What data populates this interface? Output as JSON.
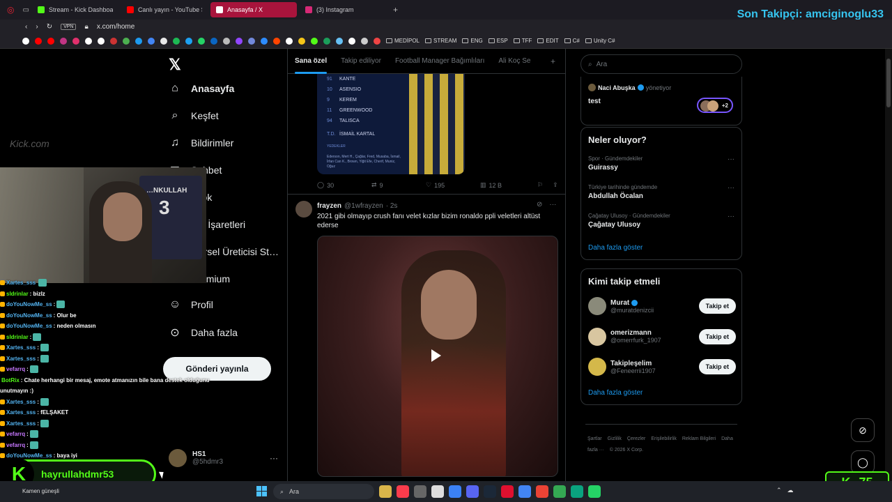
{
  "browser": {
    "tabs": [
      {
        "label": "Stream - Kick Dashboard",
        "color": "#53fc18",
        "active": false
      },
      {
        "label": "Canlı yayın - YouTube Stud",
        "color": "#ff0000",
        "active": false
      },
      {
        "label": "Anasayfa / X",
        "color": "#ffffff",
        "active": true
      },
      {
        "label": "(3) Instagram",
        "color": "#d62976",
        "active": false
      }
    ],
    "url": "x.com/home",
    "vpn_label": "VPN",
    "bookmark_folders": [
      "MEDİPOL",
      "STREAM",
      "ENG",
      "ESP",
      "TFF",
      "EDIT",
      "C#",
      "Unity C#"
    ],
    "follower_overlay": "Son Takipçi: amciginoglu33"
  },
  "x": {
    "nav": [
      {
        "label": "Anasayfa",
        "icon": "home-icon",
        "active": true
      },
      {
        "label": "Keşfet",
        "icon": "search-icon",
        "active": false
      },
      {
        "label": "Bildirimler",
        "icon": "bell-icon",
        "active": false
      },
      {
        "label": "Sohbet",
        "icon": "chat-icon",
        "active": false
      },
      {
        "label": "Grok",
        "icon": "grok-icon",
        "active": false
      },
      {
        "label": "Yer İşaretleri",
        "icon": "bookmark-icon",
        "active": false
      },
      {
        "label": "Görsel Üreticisi St…",
        "icon": "image-icon",
        "active": false
      },
      {
        "label": "Premium",
        "icon": "premium-icon",
        "active": false
      },
      {
        "label": "Profil",
        "icon": "person-icon",
        "active": false
      },
      {
        "label": "Daha fazla",
        "icon": "more-circle-icon",
        "active": false
      }
    ],
    "post_button": "Gönderi yayınla",
    "account": {
      "name": "HS1",
      "handle": "@5hdmr3"
    },
    "timeline_tabs": [
      "Sana özel",
      "Takip ediliyor",
      "Football Manager Bağımlıları",
      "Ali Koç Se"
    ],
    "tweet1": {
      "lineup": [
        {
          "num": "91",
          "name": "KANTE"
        },
        {
          "num": "10",
          "name": "ASENSIO"
        },
        {
          "num": "9",
          "name": "KEREM"
        },
        {
          "num": "11",
          "name": "GREENWOOD"
        },
        {
          "num": "94",
          "name": "TALISCA"
        }
      ],
      "coach": {
        "num": "T.D.",
        "name": "İSMAİL KARTAL"
      },
      "subs_label": "YEDEKLER",
      "subs_text": "Ederson, Mert H., Çağlar, Fred, Musaba, İsmail, İrfan Can K., Brown, Yiğit Efe, Cherif, Muniz, Oğuz",
      "stats": {
        "replies": "30",
        "retweets": "9",
        "likes": "195",
        "views": "12 B"
      }
    },
    "tweet2": {
      "name": "frayzen",
      "handle": "@1wfrayzen",
      "time": "· 2s",
      "text": "2021 gibi olmayıp crush fanı velet kızlar bizim ronaldo ppli veletleri altüst ederse"
    },
    "search_placeholder": "Ara",
    "community": {
      "by_name": "Naci Abuşka",
      "by_role": "yönetiyor",
      "title": "test",
      "members_extra": "+2"
    },
    "trends_title": "Neler oluyor?",
    "trends": [
      {
        "meta": "Spor · Gündemdekiler",
        "name": "Guirassy"
      },
      {
        "meta": "Türkiye tarihinde gündemde",
        "name": "Abdullah Öcalan"
      },
      {
        "meta": "Çağatay Ulusoy · Gündemdekiler",
        "name": "Çağatay Ulusoy"
      }
    ],
    "show_more": "Daha fazla göster",
    "who_to_follow_title": "Kimi takip etmeli",
    "who_to_follow": [
      {
        "name": "Murat",
        "handle": "@muratdenizcii",
        "verified": true,
        "button": "Takip et"
      },
      {
        "name": "omerizmann",
        "handle": "@omerrfurk_1907",
        "verified": false,
        "button": "Takip et"
      },
      {
        "name": "Takipleşelim",
        "handle": "@Feneerrii1907",
        "verified": false,
        "button": "Takip et"
      }
    ],
    "footer": [
      "Şartlar",
      "Gizlilik",
      "Çerezler",
      "Erişilebilirlik",
      "Reklam Bilgileri",
      "Daha fazla ···",
      "© 2026 X Corp."
    ]
  },
  "stream": {
    "jersey_text": "…NKULLAH",
    "jersey_num": "3",
    "kick_faint": "Kick.com",
    "chat": [
      {
        "user": "Xartes_sss",
        "msg": "",
        "color": "#53b3f0",
        "emote": true
      },
      {
        "user": "sldrinlar",
        "msg": ": bizlz",
        "color": "#53fc18",
        "emote": false
      },
      {
        "user": "doYouNowMe_ss",
        "msg": ":",
        "color": "#53b3f0",
        "emote": true
      },
      {
        "user": "doYouNowMe_ss",
        "msg": ": Olur be",
        "color": "#53b3f0",
        "emote": false
      },
      {
        "user": "doYouNowMe_ss",
        "msg": ": neden olmasın",
        "color": "#53b3f0",
        "emote": false
      },
      {
        "user": "sldrinlar",
        "msg": ":",
        "color": "#53fc18",
        "emote": true
      },
      {
        "user": "Xartes_sss",
        "msg": ":",
        "color": "#53b3f0",
        "emote": true
      },
      {
        "user": "Xartes_sss",
        "msg": ":",
        "color": "#53b3f0",
        "emote": true
      },
      {
        "user": "vefarrq",
        "msg": ":",
        "color": "#c778ff",
        "emote": true
      },
      {
        "user": "BotRix",
        "msg": ": Chate herhangi bir mesaj, emote atmanızın bile bana destek olduğunu",
        "color": "#53fc18",
        "emote": false
      },
      {
        "user": "",
        "msg": "unutmayın :)",
        "color": "#ffffff",
        "emote": false
      },
      {
        "user": "Xartes_sss",
        "msg": ":",
        "color": "#53b3f0",
        "emote": true
      },
      {
        "user": "Xartes_sss",
        "msg": ": fELŞAKET",
        "color": "#53b3f0",
        "emote": false
      },
      {
        "user": "Xartes_sss",
        "msg": ":",
        "color": "#53b3f0",
        "emote": true
      },
      {
        "user": "vefarrq",
        "msg": ":",
        "color": "#c778ff",
        "emote": true
      },
      {
        "user": "vefarrq",
        "msg": ":",
        "color": "#c778ff",
        "emote": true
      },
      {
        "user": "doYouNowMe_ss",
        "msg": ": baya iyi",
        "color": "#53b3f0",
        "emote": false
      }
    ],
    "kick_user": "hayrullahdmr53",
    "kick_count": "75"
  },
  "taskbar": {
    "weather": "Kamen güneşli",
    "search": "Ara"
  }
}
